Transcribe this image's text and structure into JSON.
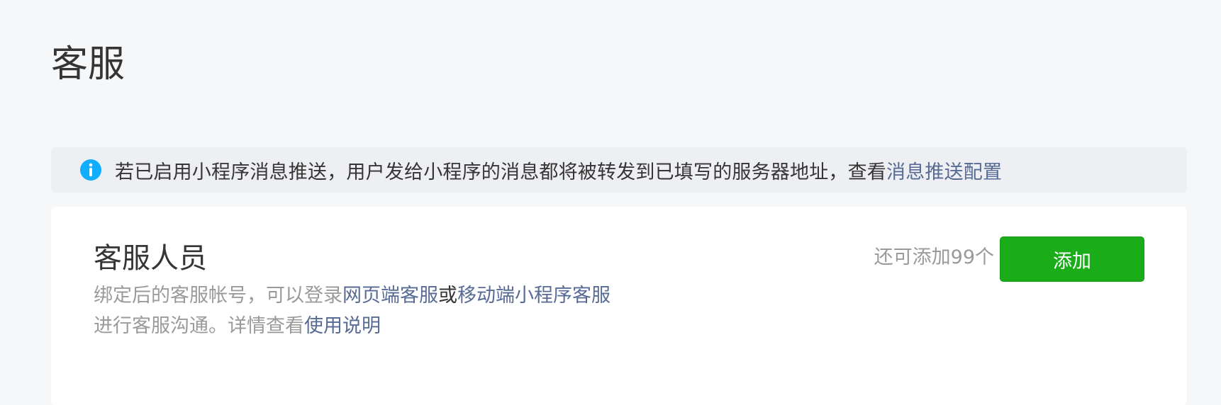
{
  "page": {
    "title": "客服"
  },
  "notice": {
    "icon": "info-icon",
    "icon_color": "#10aeff",
    "text": "若已启用小程序消息推送，用户发给小程序的消息都将被转发到已填写的服务器地址，查看",
    "link_label": "消息推送配置"
  },
  "staff": {
    "title": "客服人员",
    "desc_part1": "绑定后的客服帐号，可以登录",
    "link_web": "网页端客服",
    "desc_or": "或",
    "link_mobile": "移动端小程序客服",
    "desc_part2": "进行客服沟通。详情查看",
    "link_help": "使用说明",
    "quota_text": "还可添加99个",
    "add_label": "添加"
  },
  "colors": {
    "link": "#576b95",
    "primary_button": "#1aad19",
    "muted_text": "#9a9a9a",
    "info_icon": "#10aeff"
  }
}
